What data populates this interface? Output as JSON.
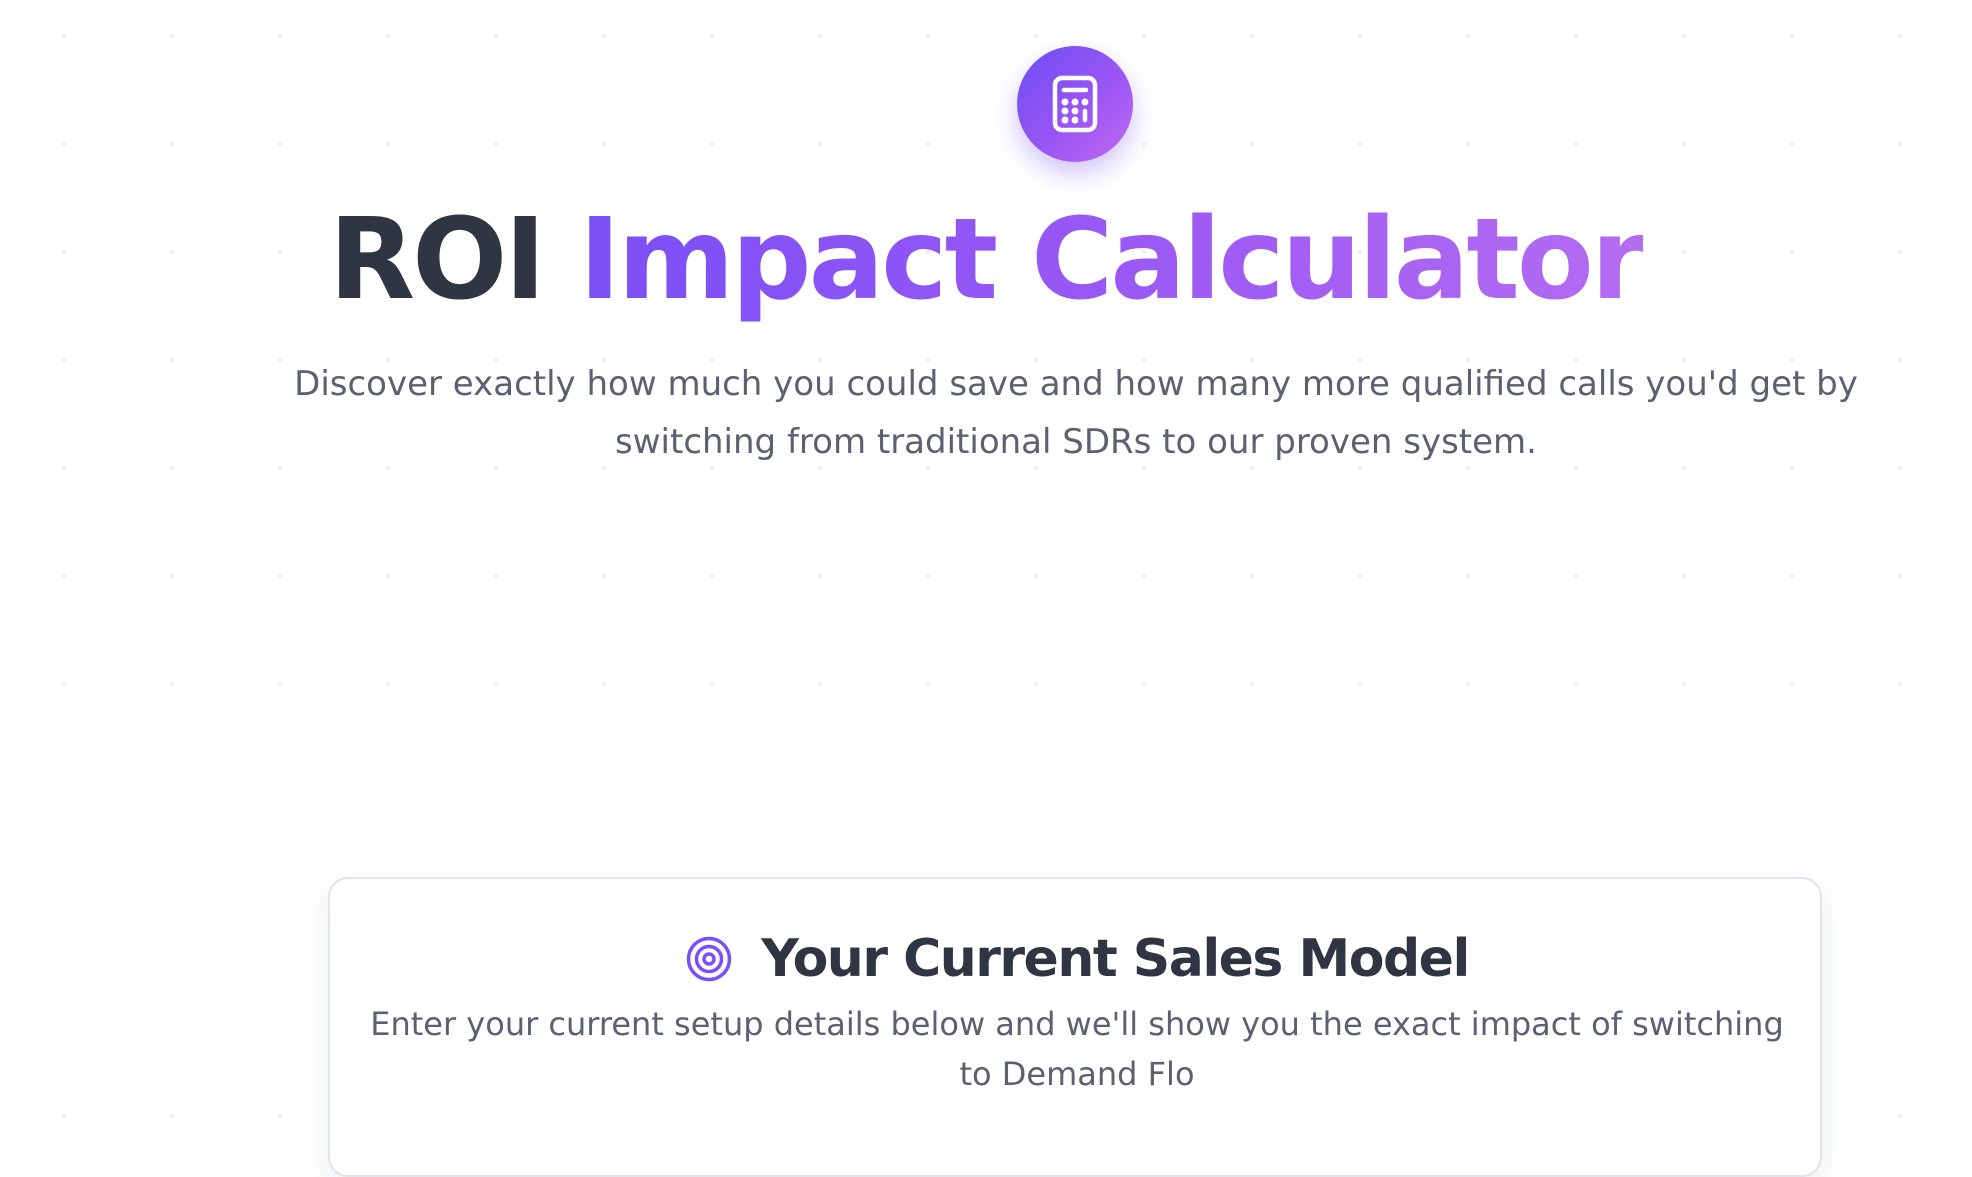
{
  "hero": {
    "icon": "calculator-icon",
    "title_prefix": "ROI",
    "title_accent": "Impact Calculator",
    "subtitle": "Discover exactly how much you could save and how many more qualified calls you'd get by switching from traditional SDRs to our proven system."
  },
  "current_model_card": {
    "icon": "target-icon",
    "title": "Your Current Sales Model",
    "subtitle": "Enter your current setup details below and we'll show you the exact impact of switching to Demand Flo"
  },
  "colors": {
    "accent_start": "#6c4ff6",
    "accent_end": "#c06af2",
    "heading": "#2f3542",
    "body_text": "#5c6070"
  }
}
